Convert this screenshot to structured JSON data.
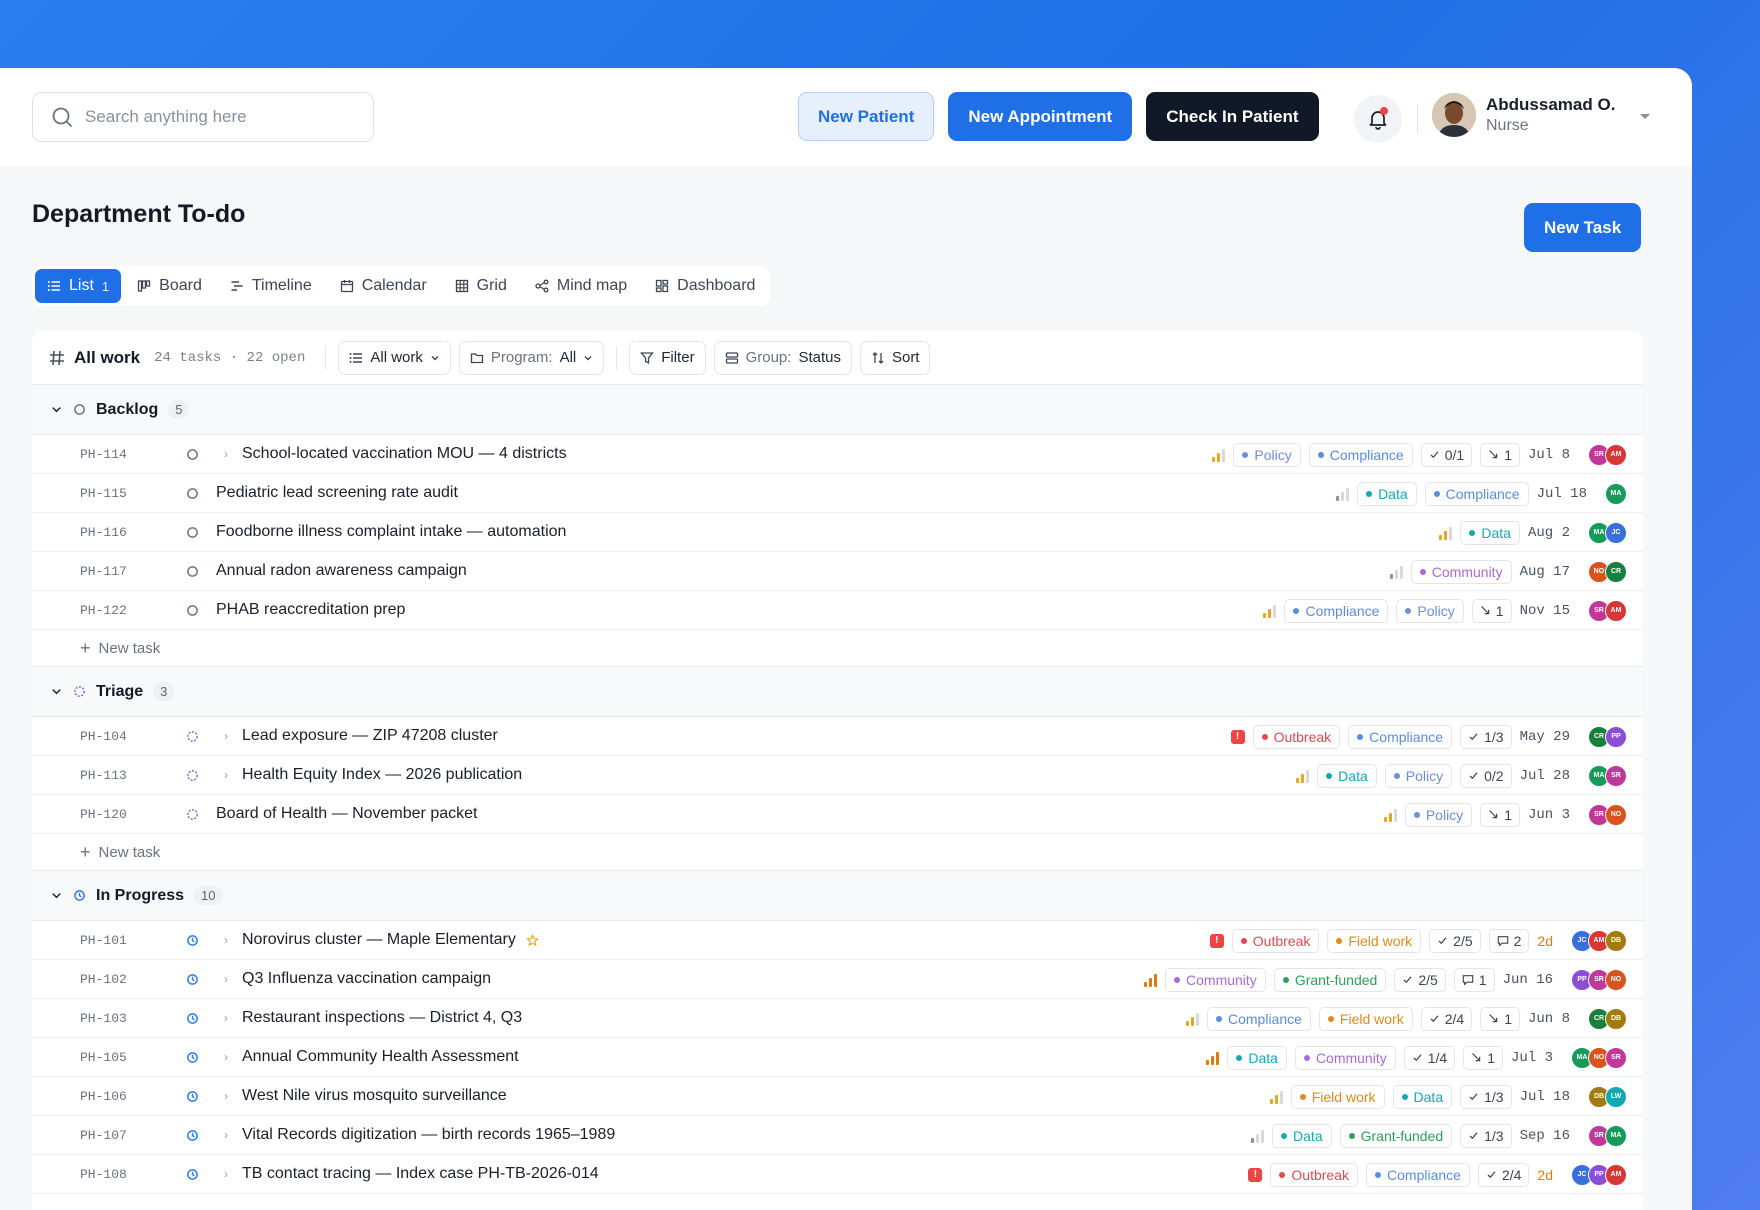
{
  "header": {
    "search_placeholder": "Search anything here",
    "buttons": {
      "new_patient": "New Patient",
      "new_appointment": "New Appointment",
      "check_in": "Check In Patient"
    },
    "user": {
      "name": "Abdussamad O.",
      "role": "Nurse"
    }
  },
  "page": {
    "title": "Department To-do",
    "new_task": "New Task"
  },
  "views": [
    {
      "label": "List",
      "count": "1",
      "icon": "list-icon",
      "active": true
    },
    {
      "label": "Board",
      "icon": "board-icon"
    },
    {
      "label": "Timeline",
      "icon": "timeline-icon"
    },
    {
      "label": "Calendar",
      "icon": "calendar-icon"
    },
    {
      "label": "Grid",
      "icon": "grid-icon"
    },
    {
      "label": "Mind map",
      "icon": "mindmap-icon"
    },
    {
      "label": "Dashboard",
      "icon": "dashboard-icon"
    }
  ],
  "toolbar": {
    "title": "All work",
    "meta": "24 tasks · 22 open",
    "all_work": "All work",
    "program_label": "Program:",
    "program_value": "All",
    "filter": "Filter",
    "group_label": "Group:",
    "group_value": "Status",
    "sort": "Sort"
  },
  "colors": {
    "Policy": "#6b8fd9",
    "Compliance": "#5b8be0",
    "Data": "#14a8b5",
    "Community": "#a86ad6",
    "Outbreak": "#e5484d",
    "Field work": "#e08a1a",
    "Grant-funded": "#2f9e5a"
  },
  "new_task_label": "New task",
  "groups": [
    {
      "name": "Backlog",
      "count": "5",
      "status": "backlog",
      "rows": [
        {
          "id": "PH-114",
          "title": "School-located vaccination MOU — 4 districts",
          "expand": true,
          "prio": "medium",
          "tags": [
            "Policy",
            "Compliance"
          ],
          "chips": [
            {
              "icon": "check",
              "text": "0/1"
            },
            {
              "icon": "subtask",
              "text": "1"
            }
          ],
          "due": "Jul 8",
          "avatars": [
            [
              "SR",
              "#c0399a"
            ],
            [
              "AM",
              "#d93636"
            ]
          ]
        },
        {
          "id": "PH-115",
          "title": "Pediatric lead screening rate audit",
          "expand": false,
          "prio": "low",
          "tags": [
            "Data",
            "Compliance"
          ],
          "chips": [],
          "due": "Jul 18",
          "avatars": [
            [
              "MA",
              "#179a5a"
            ]
          ]
        },
        {
          "id": "PH-116",
          "title": "Foodborne illness complaint intake — automation",
          "expand": false,
          "prio": "medium",
          "tags": [
            "Data"
          ],
          "chips": [],
          "due": "Aug 2",
          "avatars": [
            [
              "MA",
              "#179a5a"
            ],
            [
              "JC",
              "#3a6fd8"
            ]
          ]
        },
        {
          "id": "PH-117",
          "title": "Annual radon awareness campaign",
          "expand": false,
          "prio": "low",
          "tags": [
            "Community"
          ],
          "chips": [],
          "due": "Aug 17",
          "avatars": [
            [
              "NO",
              "#d9531e"
            ],
            [
              "CR",
              "#16803c"
            ]
          ]
        },
        {
          "id": "PH-122",
          "title": "PHAB reaccreditation prep",
          "expand": false,
          "prio": "medium",
          "tags": [
            "Compliance",
            "Policy"
          ],
          "chips": [
            {
              "icon": "subtask",
              "text": "1"
            }
          ],
          "due": "Nov 15",
          "avatars": [
            [
              "SR",
              "#c0399a"
            ],
            [
              "AM",
              "#d93636"
            ]
          ]
        }
      ]
    },
    {
      "name": "Triage",
      "count": "3",
      "status": "triage",
      "rows": [
        {
          "id": "PH-104",
          "title": "Lead exposure — ZIP 47208 cluster",
          "expand": true,
          "prio": "urgent",
          "tags": [
            "Outbreak",
            "Compliance"
          ],
          "chips": [
            {
              "icon": "check",
              "text": "1/3"
            }
          ],
          "due": "May 29",
          "avatars": [
            [
              "CR",
              "#16803c"
            ],
            [
              "PP",
              "#8b4fd6"
            ]
          ]
        },
        {
          "id": "PH-113",
          "title": "Health Equity Index — 2026 publication",
          "expand": true,
          "prio": "medium",
          "tags": [
            "Data",
            "Policy"
          ],
          "chips": [
            {
              "icon": "check",
              "text": "0/2"
            }
          ],
          "due": "Jul 28",
          "avatars": [
            [
              "MA",
              "#179a5a"
            ],
            [
              "SR",
              "#c0399a"
            ]
          ]
        },
        {
          "id": "PH-120",
          "title": "Board of Health — November packet",
          "expand": false,
          "prio": "medium",
          "tags": [
            "Policy"
          ],
          "chips": [
            {
              "icon": "subtask",
              "text": "1"
            }
          ],
          "due": "Jun 3",
          "avatars": [
            [
              "SR",
              "#c0399a"
            ],
            [
              "NO",
              "#d9531e"
            ]
          ]
        }
      ]
    },
    {
      "name": "In Progress",
      "count": "10",
      "status": "progress",
      "rows": [
        {
          "id": "PH-101",
          "title": "Norovirus cluster — Maple Elementary",
          "expand": true,
          "star": true,
          "prio": "urgent",
          "tags": [
            "Outbreak",
            "Field work"
          ],
          "chips": [
            {
              "icon": "check",
              "text": "2/5"
            },
            {
              "icon": "comment",
              "text": "2"
            }
          ],
          "due": "2d",
          "due_soon": true,
          "avatars": [
            [
              "JC",
              "#3a6fd8"
            ],
            [
              "AM",
              "#d93636"
            ],
            [
              "DB",
              "#a37a10"
            ]
          ]
        },
        {
          "id": "PH-102",
          "title": "Q3 Influenza vaccination campaign",
          "expand": true,
          "prio": "high",
          "tags": [
            "Community",
            "Grant-funded"
          ],
          "chips": [
            {
              "icon": "check",
              "text": "2/5"
            },
            {
              "icon": "comment",
              "text": "1"
            }
          ],
          "due": "Jun 16",
          "avatars": [
            [
              "PP",
              "#8b4fd6"
            ],
            [
              "SR",
              "#c0399a"
            ],
            [
              "NO",
              "#d9531e"
            ]
          ]
        },
        {
          "id": "PH-103",
          "title": "Restaurant inspections — District 4, Q3",
          "expand": true,
          "prio": "medium",
          "tags": [
            "Compliance",
            "Field work"
          ],
          "chips": [
            {
              "icon": "check",
              "text": "2/4"
            },
            {
              "icon": "subtask",
              "text": "1"
            }
          ],
          "due": "Jun 8",
          "avatars": [
            [
              "CR",
              "#16803c"
            ],
            [
              "DB",
              "#a37a10"
            ]
          ]
        },
        {
          "id": "PH-105",
          "title": "Annual Community Health Assessment",
          "expand": true,
          "prio": "high",
          "tags": [
            "Data",
            "Community"
          ],
          "chips": [
            {
              "icon": "check",
              "text": "1/4"
            },
            {
              "icon": "subtask",
              "text": "1"
            }
          ],
          "due": "Jul 3",
          "avatars": [
            [
              "MA",
              "#179a5a"
            ],
            [
              "NO",
              "#d9531e"
            ],
            [
              "SR",
              "#c0399a"
            ]
          ]
        },
        {
          "id": "PH-106",
          "title": "West Nile virus mosquito surveillance",
          "expand": true,
          "prio": "medium",
          "tags": [
            "Field work",
            "Data"
          ],
          "chips": [
            {
              "icon": "check",
              "text": "1/3"
            }
          ],
          "due": "Jul 18",
          "avatars": [
            [
              "DB",
              "#a37a10"
            ],
            [
              "LW",
              "#14a8b5"
            ]
          ]
        },
        {
          "id": "PH-107",
          "title": "Vital Records digitization — birth records 1965–1989",
          "expand": true,
          "prio": "low",
          "tags": [
            "Data",
            "Grant-funded"
          ],
          "chips": [
            {
              "icon": "check",
              "text": "1/3"
            }
          ],
          "due": "Sep 16",
          "avatars": [
            [
              "SR",
              "#c0399a"
            ],
            [
              "MA",
              "#179a5a"
            ]
          ]
        },
        {
          "id": "PH-108",
          "title": "TB contact tracing — Index case PH-TB-2026-014",
          "expand": true,
          "prio": "urgent",
          "tags": [
            "Outbreak",
            "Compliance"
          ],
          "chips": [
            {
              "icon": "check",
              "text": "2/4"
            }
          ],
          "due": "2d",
          "due_soon": true,
          "avatars": [
            [
              "JC",
              "#3a6fd8"
            ],
            [
              "PP",
              "#8b4fd6"
            ],
            [
              "AM",
              "#d93636"
            ]
          ]
        }
      ]
    }
  ]
}
